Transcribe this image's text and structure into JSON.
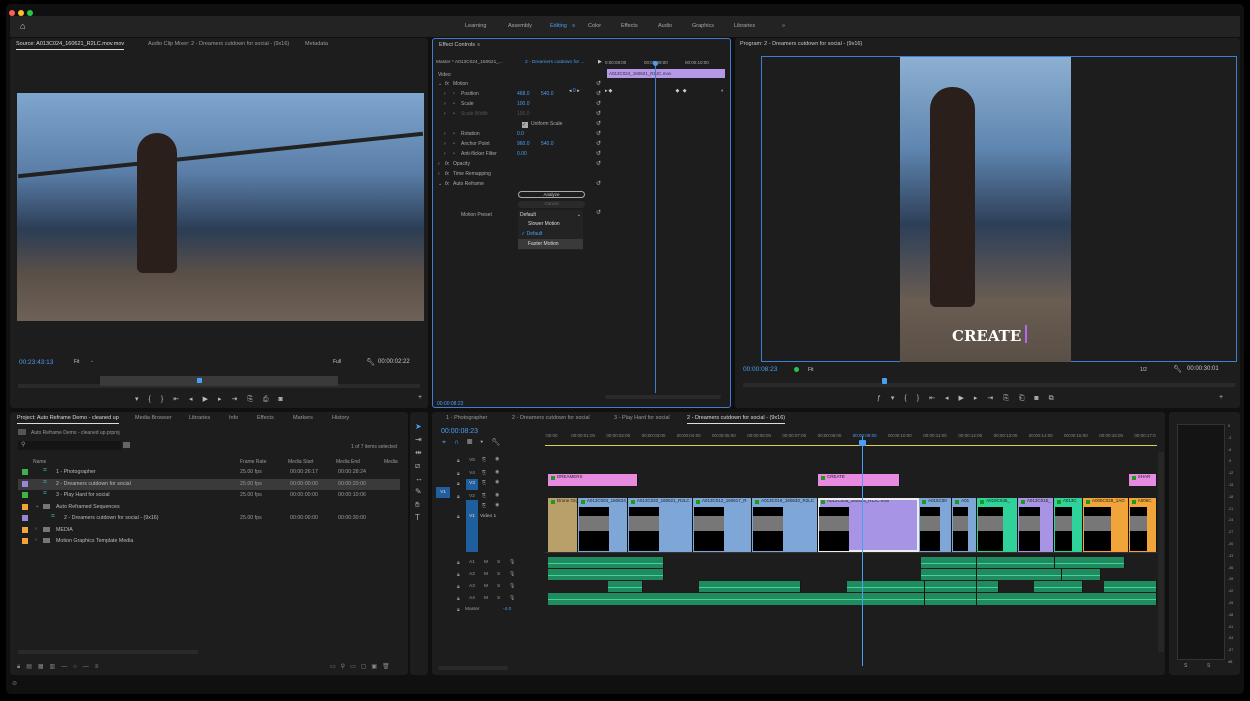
{
  "colors": {
    "accent": "#4a9ff5",
    "v_clip_blue": "#7ea7d8",
    "purple": "#a794e4",
    "pink": "#e78be0",
    "teal": "#2fd39a",
    "orange": "#f0a43a",
    "audio": "#1f8b5f",
    "label_green": "#3cb44b",
    "label_purple": "#9a86d8",
    "label_orange": "#f0a43a"
  },
  "topbar": {
    "home_icon": "home-icon",
    "workspaces": [
      "Learning",
      "Assembly",
      "Editing",
      "Color",
      "Effects",
      "Audio",
      "Graphics",
      "Libraries"
    ],
    "active_workspace": "Editing",
    "more": "»"
  },
  "source": {
    "tabs": [
      "Source: A013C024_160621_R2LC.mov.mov",
      "Audio Clip Mixer: 2 - Dreamers cutdown for social - (9x16)",
      "Metadata"
    ],
    "timecode": "00:23:43:13",
    "fit": "Fit",
    "quality": "Full",
    "duration": "00:00:02:22"
  },
  "effect_controls": {
    "title": "Effect Controls",
    "master": "Master * A013C024_160621_...",
    "sequence": "2 - Dreamers cutdown for ...",
    "ruler": [
      "0:00:08:00",
      "00:00:09:00",
      "00:00:10:00"
    ],
    "clip_name": "A013C024_160621_R1JC.mov",
    "section": "Video",
    "rows": [
      {
        "label": "Motion",
        "fx": true
      },
      {
        "label": "Position",
        "v1": "468.0",
        "v2": "540.0"
      },
      {
        "label": "Scale",
        "v1": "100.0"
      },
      {
        "label": "Scale Width",
        "v1": "100.0"
      },
      {
        "label": "Uniform Scale"
      },
      {
        "label": "Rotation",
        "v1": "0.0"
      },
      {
        "label": "Anchor Point",
        "v1": "960.0",
        "v2": "540.0"
      },
      {
        "label": "Anti-flicker Filter",
        "v1": "0.00"
      },
      {
        "label": "Opacity",
        "fx": true
      },
      {
        "label": "Time Remapping",
        "fx": true
      },
      {
        "label": "Auto Reframe",
        "fx": true
      }
    ],
    "kf_index": "0",
    "analyze": "Analyze",
    "cancel": "Cancel",
    "motion_preset_label": "Motion Preset",
    "motion_preset_value": "Default",
    "preset_options": [
      "Slower Motion",
      "Default",
      "Faster Motion"
    ],
    "selected_option": "Default",
    "timecode": "00:00:08:23"
  },
  "program": {
    "title": "Program: 2 - Dreamers cutdown for social - (9x16)",
    "timecode": "00:00:08:23",
    "fit": "Fit",
    "quality": "1/2",
    "duration": "00:00:30:01",
    "overlay_text": "CREATE"
  },
  "project": {
    "tabs": [
      "Project: Auto Reframe Demo - cleaned up",
      "Media Browser",
      "Libraries",
      "Info",
      "Effects",
      "Markers",
      "History"
    ],
    "path": "Auto Reframe Demo - cleaned up.prproj",
    "selection": "1 of 7 items selected",
    "columns": [
      "Name",
      "Frame Rate",
      "Media Start",
      "Media End",
      "Media"
    ],
    "items": [
      {
        "name": "1 - Photographer",
        "rate": "25.00 fps",
        "start": "00:00:26:17",
        "end": "00:00:28:24",
        "label": "#3cb44b",
        "type": "seq",
        "indent": 0
      },
      {
        "name": "2 - Dreamers cutdown for social",
        "rate": "25.00 fps",
        "start": "00:00:00:00",
        "end": "00:00:20:00",
        "label": "#9a86d8",
        "type": "seq",
        "indent": 0,
        "selected": true
      },
      {
        "name": "3 - Play Hard for social",
        "rate": "25.00 fps",
        "start": "00:00:00:00",
        "end": "00:00:10:06",
        "label": "#3cb44b",
        "type": "seq",
        "indent": 0
      },
      {
        "name": "Auto Reframed Sequences",
        "label": "#f0a43a",
        "type": "folder-open",
        "indent": 0
      },
      {
        "name": "2 - Dreamers cutdown for social - (9x16)",
        "rate": "25.00 fps",
        "start": "00:00:00:00",
        "end": "00:00:30:00",
        "label": "#9a86d8",
        "type": "seq",
        "indent": 1
      },
      {
        "name": "MEDIA",
        "label": "#f0a43a",
        "type": "folder",
        "indent": 0
      },
      {
        "name": "Motion Graphics Template Media",
        "label": "#f0a43a",
        "type": "folder",
        "indent": 0
      }
    ]
  },
  "timeline": {
    "tabs": [
      "1 - Photographer",
      "2 - Dreamers cutdown for social",
      "3 - Play Hard for social",
      "2 - Dreamers cutdown for social - (9x16)"
    ],
    "timecode": "00:00:08:23",
    "playhead_seconds": 8.92,
    "ruler": [
      ":00:00",
      "00:00:01:00",
      "00:00:02:00",
      "00:00:03:00",
      "00:00:04:00",
      "00:00:05:00",
      "00:00:06:00",
      "00:00:07:00",
      "00:00:08:00",
      "00:00:09:00",
      "00:00:10:00",
      "00:00:11:00",
      "00:00:12:00",
      "00:00:13:00",
      "00:00:14:00",
      "00:00:15:00",
      "00:00:16:00",
      "00:00:17:0"
    ],
    "video_tracks": [
      "V5",
      "V4",
      "V3",
      "V2",
      "V1"
    ],
    "video1_name": "Video 1",
    "audio_tracks": [
      "A1",
      "A2",
      "A3",
      "A4"
    ],
    "master_label": "Master",
    "master_value": "-4.0",
    "source_patch": "V1",
    "v3_clips": [
      {
        "name": "DREAMERS",
        "start": 0,
        "end": 2.56,
        "color": "#e78be0"
      },
      {
        "name": "CREATE",
        "start": 7.67,
        "end": 10.0,
        "color": "#e78be0"
      },
      {
        "name": "SHAR",
        "start": 16.5,
        "end": 17.3,
        "color": "#e78be0"
      }
    ],
    "v1_clips": [
      {
        "name": "Drone Orgie",
        "start": 0,
        "end": 0.85,
        "color": "#b9a06a"
      },
      {
        "name": "A013C004_160634_R",
        "start": 0.85,
        "end": 2.27,
        "color": "#7ea7d8"
      },
      {
        "name": "A013C020_160621_R2LC",
        "start": 2.27,
        "end": 4.12,
        "color": "#7ea7d8"
      },
      {
        "name": "A013C012_160617_R",
        "start": 4.12,
        "end": 5.8,
        "color": "#7ea7d8"
      },
      {
        "name": "A013C018_160630_R2LC",
        "start": 5.8,
        "end": 7.67,
        "color": "#7ea7d8"
      },
      {
        "name": "A012C005_160525_R1JC.mov",
        "start": 7.67,
        "end": 10.54,
        "color": "#a794e4",
        "selected": true
      },
      {
        "name": "A015C00",
        "start": 10.54,
        "end": 11.48,
        "color": "#7ea7d8"
      },
      {
        "name": "A01",
        "start": 11.48,
        "end": 12.19,
        "color": "#7ea7d8"
      },
      {
        "name": "A019C045_",
        "start": 12.19,
        "end": 13.35,
        "color": "#2fd39a"
      },
      {
        "name": "A013C015_",
        "start": 13.35,
        "end": 14.37,
        "color": "#a794e4"
      },
      {
        "name": "A013C",
        "start": 14.37,
        "end": 15.2,
        "color": "#2fd39a"
      },
      {
        "name": "A005C028_1AG",
        "start": 15.2,
        "end": 16.5,
        "color": "#f0a43a"
      },
      {
        "name": "A006C",
        "start": 16.5,
        "end": 17.3,
        "color": "#f0a43a"
      }
    ],
    "audio_clips": [
      [
        {
          "start": 0,
          "end": 3.3
        },
        {
          "start": 10.6,
          "end": 12.2
        },
        {
          "start": 12.2,
          "end": 14.4
        },
        {
          "start": 14.4,
          "end": 16.4
        }
      ],
      [
        {
          "start": 0,
          "end": 3.3
        },
        {
          "start": 10.6,
          "end": 12.2
        },
        {
          "start": 12.2,
          "end": 14.6
        },
        {
          "start": 14.6,
          "end": 15.7
        }
      ],
      [
        {
          "start": 1.7,
          "end": 2.7
        },
        {
          "start": 4.3,
          "end": 7.2
        },
        {
          "start": 8.5,
          "end": 10.7
        },
        {
          "start": 10.7,
          "end": 12.2
        },
        {
          "start": 12.2,
          "end": 12.8
        },
        {
          "start": 13.8,
          "end": 15.2
        },
        {
          "start": 15.8,
          "end": 17.3
        }
      ],
      [
        {
          "start": 0,
          "end": 10.7
        },
        {
          "start": 10.7,
          "end": 12.2
        },
        {
          "start": 12.2,
          "end": 17.3
        }
      ]
    ]
  },
  "meter": {
    "scale": [
      "0",
      "-3",
      "-6",
      "-9",
      "-12",
      "-15",
      "-18",
      "-21",
      "-24",
      "-27",
      "-30",
      "-33",
      "-36",
      "-39",
      "-42",
      "-45",
      "-48",
      "-51",
      "-54",
      "-57",
      "dB"
    ],
    "channels": [
      "S",
      "S"
    ]
  }
}
